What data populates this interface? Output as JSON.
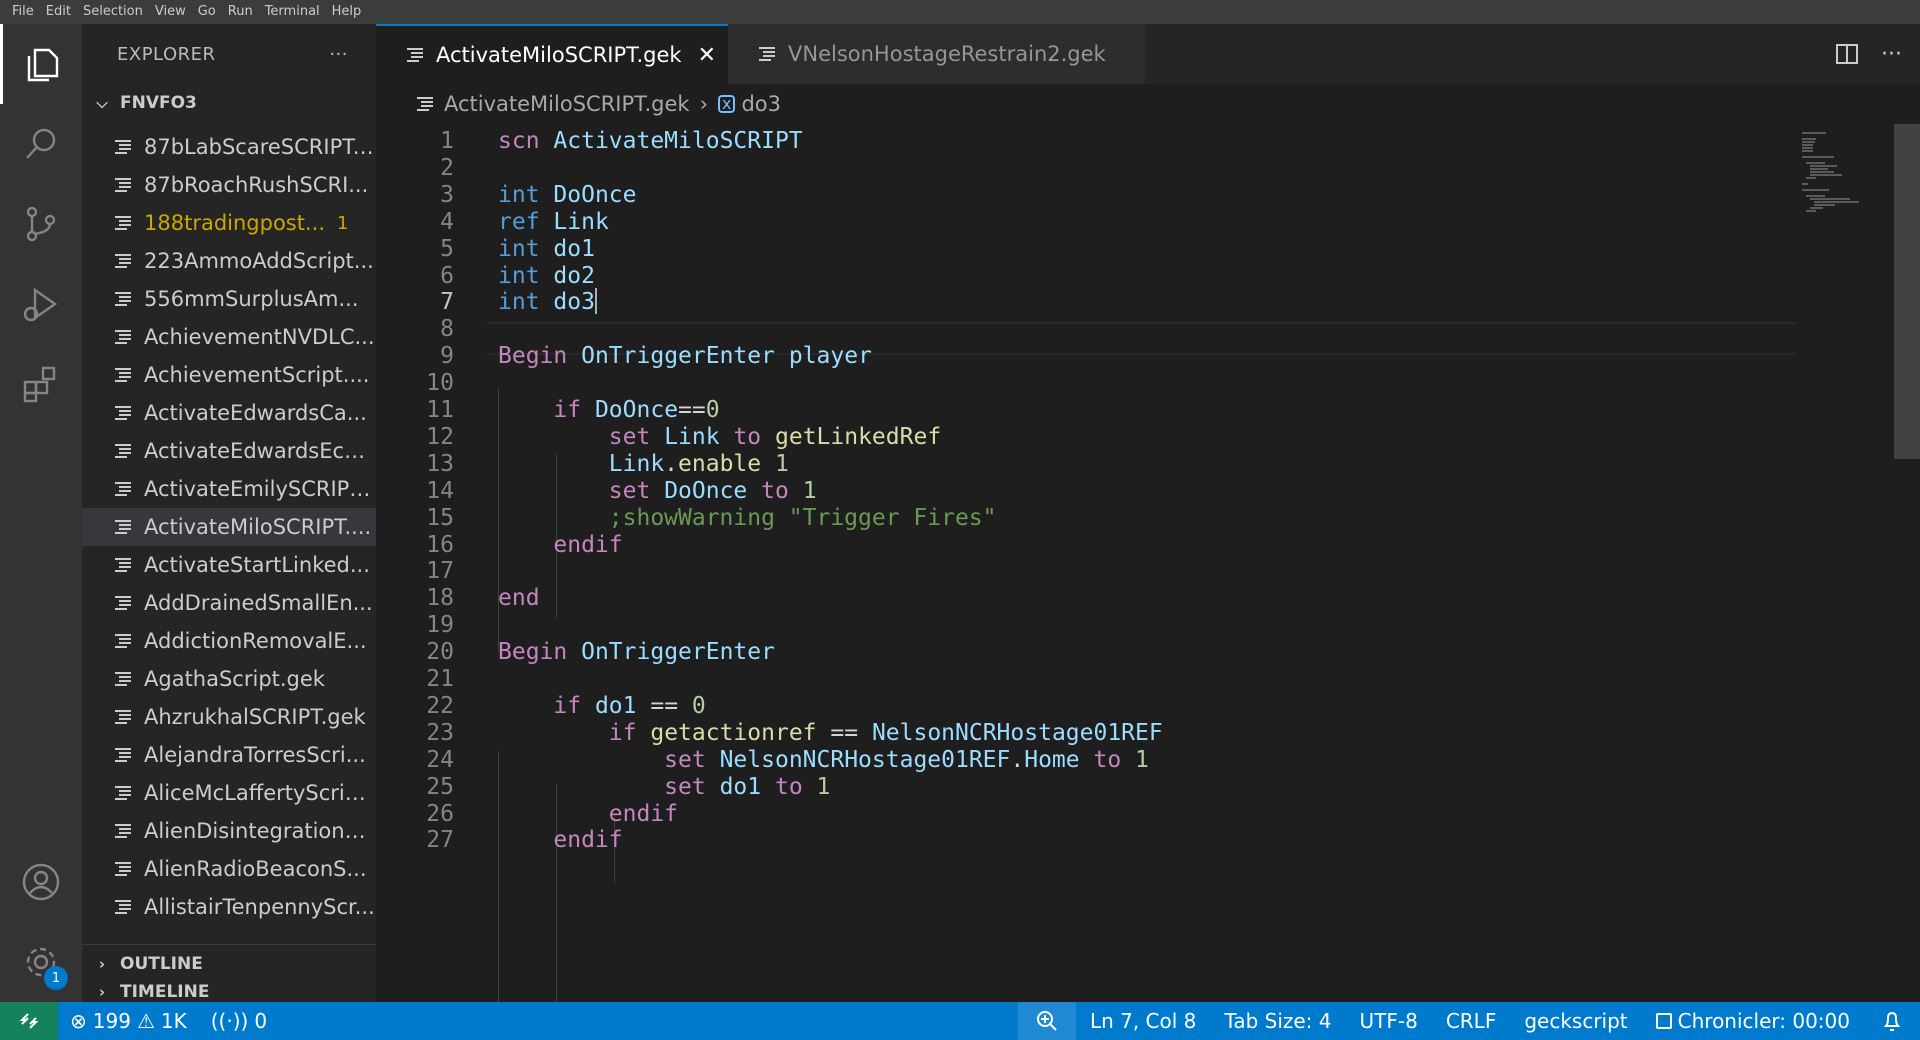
{
  "menubar": [
    "File",
    "Edit",
    "Selection",
    "View",
    "Go",
    "Run",
    "Terminal",
    "Help"
  ],
  "activity": {
    "icons": [
      "explorer-icon",
      "search-icon",
      "source-control-icon",
      "run-debug-icon",
      "extensions-icon",
      "accounts-icon",
      "manage-gear-icon"
    ],
    "gear_badge": "1"
  },
  "sidebar": {
    "title": "EXPLORER",
    "more": "···",
    "folder": "FNVFO3",
    "files": [
      {
        "name": "87bLabScareSCRIPT....",
        "badge": ""
      },
      {
        "name": "87bRoachRushSCRI...",
        "badge": ""
      },
      {
        "name": "188tradingpost...",
        "badge": "1"
      },
      {
        "name": "223AmmoAddScript...",
        "badge": ""
      },
      {
        "name": "556mmSurplusAm...",
        "badge": ""
      },
      {
        "name": "AchievementNVDLC...",
        "badge": ""
      },
      {
        "name": "AchievementScript....",
        "badge": ""
      },
      {
        "name": "ActivateEdwardsCa...",
        "badge": ""
      },
      {
        "name": "ActivateEdwardsEch...",
        "badge": ""
      },
      {
        "name": "ActivateEmilySCRIPT...",
        "badge": ""
      },
      {
        "name": "ActivateMiloSCRIPT....",
        "badge": ""
      },
      {
        "name": "ActivateStartLinked...",
        "badge": ""
      },
      {
        "name": "AddDrainedSmallEn...",
        "badge": ""
      },
      {
        "name": "AddictionRemovalE...",
        "badge": ""
      },
      {
        "name": "AgathaScript.gek",
        "badge": ""
      },
      {
        "name": "AhzrukhalSCRIPT.gek",
        "badge": ""
      },
      {
        "name": "AlejandraTorresScri...",
        "badge": ""
      },
      {
        "name": "AliceMcLaffertyScrip...",
        "badge": ""
      },
      {
        "name": "AlienDisintegrationE...",
        "badge": ""
      },
      {
        "name": "AlienRadioBeaconS...",
        "badge": ""
      },
      {
        "name": "AllistairTenpennyScr...",
        "badge": ""
      }
    ],
    "outline": "OUTLINE",
    "timeline": "TIMELINE"
  },
  "tabs": [
    {
      "label": "ActivateMiloSCRIPT.gek",
      "close": "✕"
    },
    {
      "label": "VNelsonHostageRestrain2.gek"
    }
  ],
  "breadcrumb": {
    "file": "ActivateMiloSCRIPT.gek",
    "symbol": "do3"
  },
  "editor": {
    "line_numbers": [
      "1",
      "2",
      "3",
      "4",
      "5",
      "6",
      "7",
      "8",
      "9",
      "10",
      "11",
      "12",
      "13",
      "14",
      "15",
      "16",
      "17",
      "18",
      "19",
      "20",
      "21",
      "22",
      "23",
      "24",
      "25",
      "26",
      "27"
    ],
    "current_line": "7"
  },
  "status": {
    "errors": "199",
    "warnings": "1K",
    "ports": "0",
    "position": "Ln 7, Col 8",
    "tab_size": "Tab Size: 4",
    "encoding": "UTF-8",
    "eol": "CRLF",
    "language": "geckscript",
    "chronicler": "Chronicler: 00:00"
  },
  "colors": {
    "accent": "#007acc",
    "remote": "#16825d",
    "warning": "#cca700"
  }
}
